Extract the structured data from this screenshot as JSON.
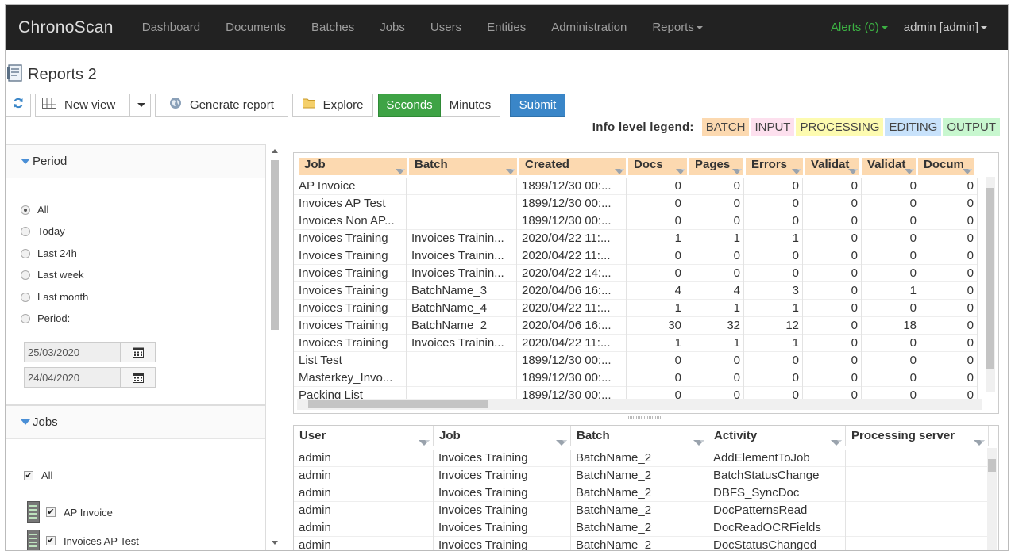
{
  "navbar": {
    "brand": "ChronoScan",
    "items": [
      "Dashboard",
      "Documents",
      "Batches",
      "Jobs",
      "Users",
      "Entities",
      "Administration",
      "Reports"
    ],
    "alerts": "Alerts (0)",
    "user": "admin [admin]"
  },
  "page": {
    "title": "Reports 2"
  },
  "toolbar": {
    "new_view": "New view",
    "generate_report": "Generate report",
    "explore": "Explore",
    "seconds": "Seconds",
    "minutes": "Minutes",
    "submit": "Submit"
  },
  "legend": {
    "label": "Info level legend:",
    "tags": [
      {
        "text": "BATCH",
        "color": "#fcd9b0"
      },
      {
        "text": "INPUT",
        "color": "#fde0ee"
      },
      {
        "text": "PROCESSING",
        "color": "#fdfbb0"
      },
      {
        "text": "EDITING",
        "color": "#c8e2fb"
      },
      {
        "text": "OUTPUT",
        "color": "#c8f7cf"
      }
    ]
  },
  "period": {
    "title": "Period",
    "options": [
      "All",
      "Today",
      "Last 24h",
      "Last week",
      "Last month",
      "Period:"
    ],
    "selected": "All",
    "date_from": "25/03/2020",
    "date_to": "24/04/2020"
  },
  "jobs": {
    "title": "Jobs",
    "all": "All",
    "items": [
      "AP Invoice",
      "Invoices AP Test"
    ]
  },
  "top_grid": {
    "headers": [
      "Job",
      "Batch",
      "Created",
      "Docs",
      "Pages",
      "Errors",
      "Validat",
      "Validat",
      "Docum"
    ],
    "rows": [
      [
        "AP Invoice",
        "",
        "1899/12/30 00:...",
        "0",
        "0",
        "0",
        "0",
        "0",
        "0"
      ],
      [
        "Invoices AP Test",
        "",
        "1899/12/30 00:...",
        "0",
        "0",
        "0",
        "0",
        "0",
        "0"
      ],
      [
        "Invoices Non AP...",
        "",
        "1899/12/30 00:...",
        "0",
        "0",
        "0",
        "0",
        "0",
        "0"
      ],
      [
        "Invoices Training",
        "Invoices Trainin...",
        "2020/04/22 11:...",
        "1",
        "1",
        "1",
        "0",
        "0",
        "0"
      ],
      [
        "Invoices Training",
        "Invoices Trainin...",
        "2020/04/22 11:...",
        "0",
        "0",
        "0",
        "0",
        "0",
        "0"
      ],
      [
        "Invoices Training",
        "Invoices Trainin...",
        "2020/04/22 14:...",
        "0",
        "0",
        "0",
        "0",
        "0",
        "0"
      ],
      [
        "Invoices Training",
        "BatchName_3",
        "2020/04/06 16:...",
        "4",
        "4",
        "3",
        "0",
        "1",
        "0"
      ],
      [
        "Invoices Training",
        "BatchName_4",
        "2020/04/22 11:...",
        "1",
        "1",
        "1",
        "0",
        "0",
        "0"
      ],
      [
        "Invoices Training",
        "BatchName_2",
        "2020/04/06 16:...",
        "30",
        "32",
        "12",
        "0",
        "18",
        "0"
      ],
      [
        "Invoices Training",
        "Invoices Trainin...",
        "2020/04/22 11:...",
        "1",
        "1",
        "1",
        "0",
        "0",
        "0"
      ],
      [
        "List Test",
        "",
        "1899/12/30 00:...",
        "0",
        "0",
        "0",
        "0",
        "0",
        "0"
      ],
      [
        "Masterkey_Invo...",
        "",
        "1899/12/30 00:...",
        "0",
        "0",
        "0",
        "0",
        "0",
        "0"
      ],
      [
        "Packing List",
        "",
        "1899/12/30 00:...",
        "0",
        "0",
        "0",
        "0",
        "0",
        "0"
      ]
    ]
  },
  "bottom_grid": {
    "headers": [
      "User",
      "Job",
      "Batch",
      "Activity",
      "Processing server"
    ],
    "rows": [
      [
        "admin",
        "Invoices Training",
        "BatchName_2",
        "AddElementToJob",
        ""
      ],
      [
        "admin",
        "Invoices Training",
        "BatchName_2",
        "BatchStatusChange",
        ""
      ],
      [
        "admin",
        "Invoices Training",
        "BatchName_2",
        "DBFS_SyncDoc",
        ""
      ],
      [
        "admin",
        "Invoices Training",
        "BatchName_2",
        "DocPatternsRead",
        ""
      ],
      [
        "admin",
        "Invoices Training",
        "BatchName_2",
        "DocReadOCRFields",
        ""
      ],
      [
        "admin",
        "Invoices Training",
        "BatchName_2",
        "DocStatusChanged",
        ""
      ]
    ]
  }
}
